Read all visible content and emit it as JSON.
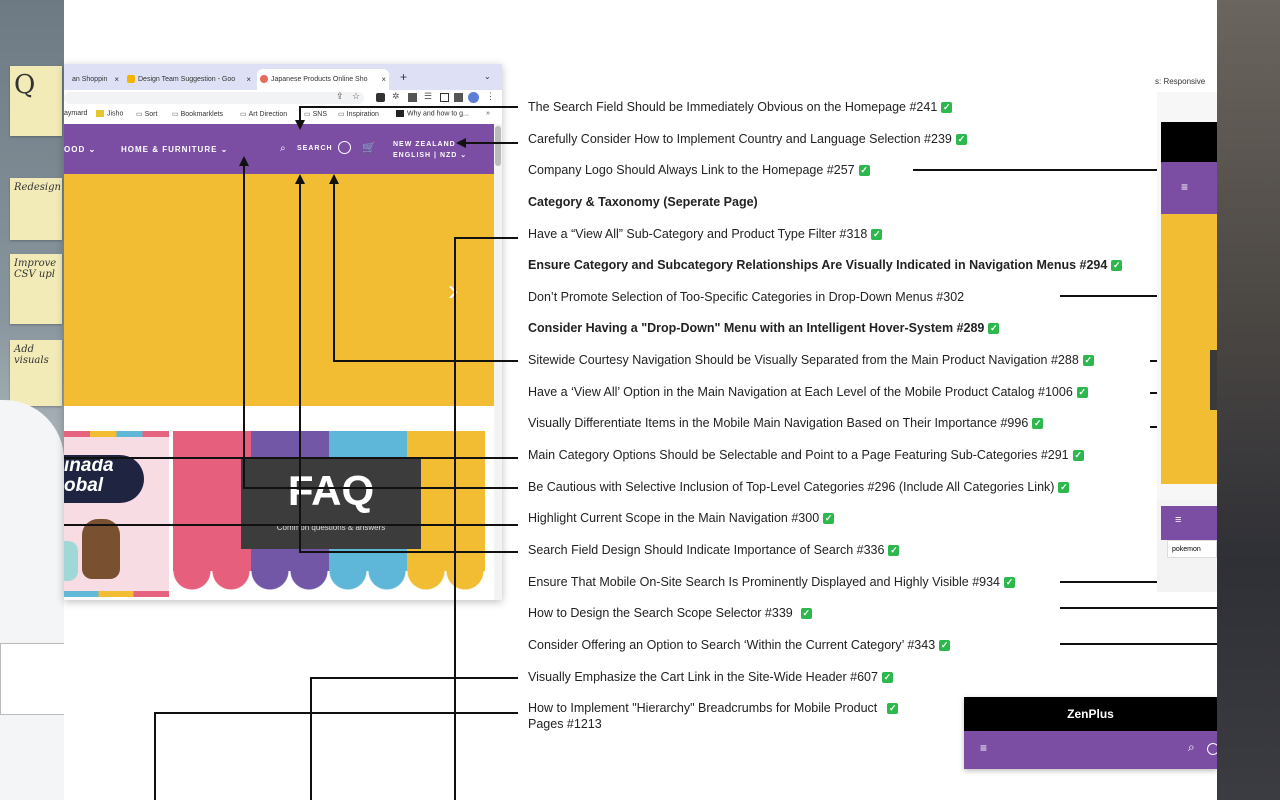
{
  "left_notes": [
    "Q",
    "Redesign",
    "Improve CSV upl",
    "Add visuals"
  ],
  "browser": {
    "tabs": [
      {
        "label": "an Shoppin"
      },
      {
        "label": "Design Team Suggestion - Goo"
      },
      {
        "label": "Japanese Products Online Sho"
      }
    ],
    "new_tab": "+",
    "bookmarks": [
      "aymard",
      "Jisho",
      "Sort",
      "Bookmarklets",
      "Art Direction",
      "SNS",
      "Inspiration",
      "Why and how to g..."
    ],
    "nav": {
      "item_partial": "OOD",
      "item_home": "HOME & FURNITURE",
      "search_label": "SEARCH",
      "region_line1": "NEW ZEALAND",
      "region_line2": "ENGLISH | NZD"
    },
    "banner_left": {
      "line1": "inada",
      "line2": "obal"
    },
    "faq": {
      "title": "FAQ",
      "subtitle": "Common questions & answers"
    },
    "next_arrow": "›"
  },
  "annotations": [
    {
      "text": "The Search Field Should be Immediately Obvious on the Homepage #241",
      "bold": false
    },
    {
      "text": "Carefully Consider How to Implement Country and Language Selection #239",
      "bold": false
    },
    {
      "text": "Company Logo Should Always Link to the Homepage #257",
      "bold": false
    },
    {
      "text": "Category & Taxonomy (Seperate Page)",
      "bold": true
    },
    {
      "text": "Have a “View All” Sub-Category and Product Type Filter #318",
      "bold": false
    },
    {
      "text": "Ensure Category and Subcategory Relationships Are Visually Indicated in Navigation Menus #294",
      "bold": true
    },
    {
      "text": "Don’t Promote Selection of Too-Specific Categories in Drop-Down Menus #302",
      "bold": false
    },
    {
      "text": "Consider Having a \"Drop-Down\" Menu with an Intelligent Hover-System #289",
      "bold": true
    },
    {
      "text": "Sitewide Courtesy Navigation Should be Visually Separated from the Main Product Navigation #288",
      "bold": false
    },
    {
      "text": "Have a ‘View All’ Option in the Main Navigation at Each Level of the Mobile Product Catalog #1006",
      "bold": false
    },
    {
      "text": "Visually Differentiate Items in the Mobile Main Navigation Based on Their Importance #996",
      "bold": false
    },
    {
      "text": "Main Category Options Should be Selectable and Point to a Page Featuring Sub-Categories #291",
      "bold": false
    },
    {
      "text": "Be Cautious with Selective Inclusion of Top-Level Categories #296 (Include All Categories Link)",
      "bold": false
    },
    {
      "text": "Highlight Current Scope in the Main Navigation #300",
      "bold": false
    },
    {
      "text": "Search Field Design Should Indicate Importance of Search #336",
      "bold": false
    },
    {
      "text": "Ensure That Mobile On-Site Search Is Prominently Displayed and Highly Visible #934",
      "bold": false
    },
    {
      "text": "How to Design the Search Scope Selector #339",
      "bold": false
    },
    {
      "text": "Consider Offering an Option to Search ‘Within the Current Category’ #343",
      "bold": false
    },
    {
      "text": "Visually Emphasize the Cart Link in the Site-Wide Header #607",
      "bold": false
    },
    {
      "text": "How to Implement \"Hierarchy\" Breadcrumbs for Mobile Product",
      "bold": false
    }
  ],
  "annotation_last_line2": "Pages #1213",
  "check_symbol": "✓",
  "right": {
    "responsive_title": "s: Responsive",
    "mobile_search_value": "pokemon",
    "zen_logo": "ZenPlus"
  },
  "colors": {
    "purple": "#7b4ea3",
    "yellow": "#f2bd32",
    "check_green": "#2db84d"
  }
}
